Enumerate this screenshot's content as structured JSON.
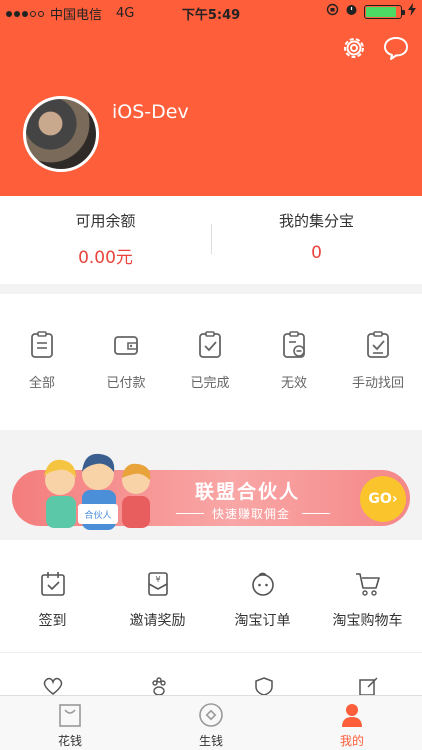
{
  "status_bar": {
    "carrier": "中国电信",
    "network": "4G",
    "time": "下午5:49"
  },
  "profile": {
    "username": "iOS-Dev"
  },
  "balance": {
    "available_label": "可用余额",
    "available_value": "0.00元",
    "points_label": "我的集分宝",
    "points_value": "0"
  },
  "orders": [
    {
      "label": "全部",
      "icon": "clipboard-icon"
    },
    {
      "label": "已付款",
      "icon": "wallet-icon"
    },
    {
      "label": "已完成",
      "icon": "clipboard-check-icon"
    },
    {
      "label": "无效",
      "icon": "clipboard-minus-icon"
    },
    {
      "label": "手动找回",
      "icon": "clipboard-retrieve-icon"
    }
  ],
  "banner": {
    "title": "联盟合伙人",
    "subtitle": "快速赚取佣金",
    "go": "GO",
    "sign": "合伙人"
  },
  "tools": [
    {
      "label": "签到",
      "icon": "calendar-check-icon"
    },
    {
      "label": "邀请奖励",
      "icon": "red-envelope-icon"
    },
    {
      "label": "淘宝订单",
      "icon": "taobao-face-icon"
    },
    {
      "label": "淘宝购物车",
      "icon": "cart-icon"
    }
  ],
  "tabs": [
    {
      "label": "花钱",
      "icon": "bag-icon"
    },
    {
      "label": "生钱",
      "icon": "coin-icon"
    },
    {
      "label": "我的",
      "icon": "person-icon"
    }
  ],
  "colors": {
    "accent": "#ff5e3a",
    "value_red": "#e8453c",
    "banner_pink": "#f47d7d",
    "go_yellow": "#f9c42c"
  }
}
